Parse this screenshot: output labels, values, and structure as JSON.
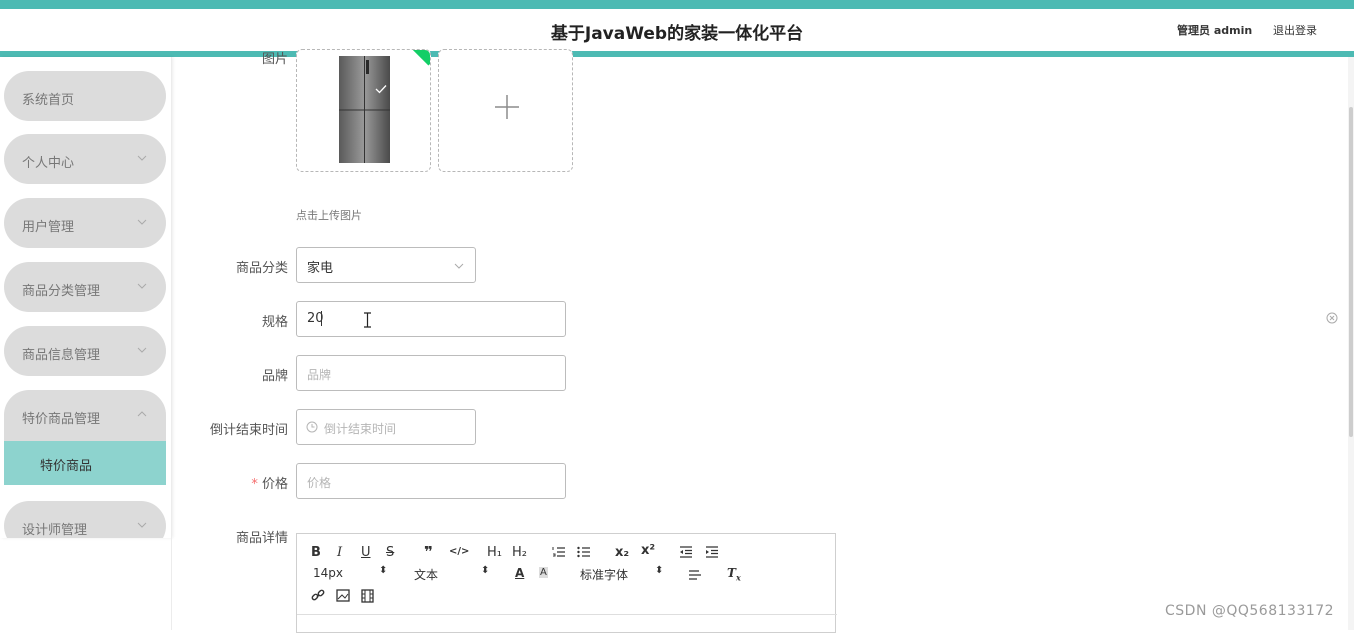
{
  "header": {
    "title": "基于JavaWeb的家装一体化平台",
    "user_label": "管理员 admin",
    "logout_label": "退出登录"
  },
  "sidebar": {
    "items": [
      {
        "label": "系统首页"
      },
      {
        "label": "个人中心"
      },
      {
        "label": "用户管理"
      },
      {
        "label": "商品分类管理"
      },
      {
        "label": "商品信息管理"
      },
      {
        "label": "特价商品管理"
      },
      {
        "label": "设计师管理"
      }
    ],
    "active_sub": "特价商品"
  },
  "form": {
    "image_label": "图片",
    "upload_hint": "点击上传图片",
    "category_label": "商品分类",
    "category_value": "家电",
    "spec_label": "规格",
    "spec_value": "20",
    "brand_label": "品牌",
    "brand_placeholder": "品牌",
    "countdown_label": "倒计结束时间",
    "countdown_placeholder": "倒计结束时间",
    "price_label": "价格",
    "price_required": "*",
    "price_placeholder": "价格",
    "detail_label": "商品详情"
  },
  "editor": {
    "font_size": "14px",
    "paragraph": "文本",
    "font_family": "标准字体"
  },
  "watermark": "CSDN @QQ568133172",
  "colors": {
    "accent": "#4dbab3",
    "active_sub_bg": "#8dd3ce",
    "menu_bg": "#dcdcdc",
    "required": "#f56c6c"
  }
}
